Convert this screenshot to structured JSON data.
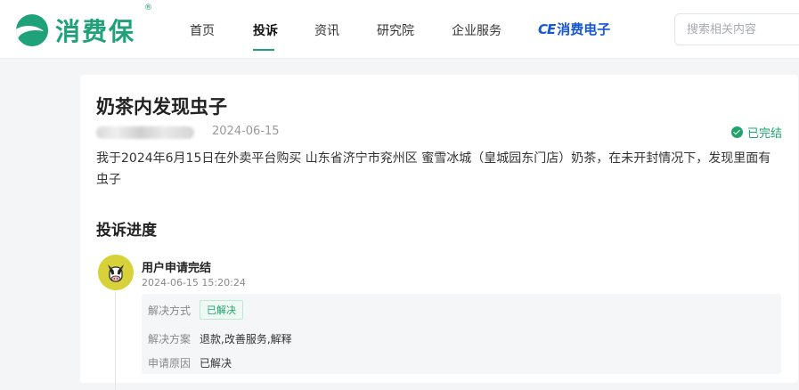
{
  "brand": {
    "name": "消费保",
    "registered": "®",
    "color": "#1fa17a"
  },
  "nav": {
    "items": [
      "首页",
      "投诉",
      "资讯",
      "研究院",
      "企业服务"
    ],
    "active": "投诉",
    "partner": {
      "ce": "CE",
      "label": "消费电子"
    }
  },
  "search": {
    "placeholder": "搜索相关内容"
  },
  "complaint": {
    "title": "奶茶内发现虫子",
    "date": "2024-06-15",
    "status": "已完结",
    "description": "我于2024年6月15日在外卖平台购买 山东省济宁市兖州区 蜜雪冰城（皇城园东门店）奶茶，在未开封情况下，发现里面有虫子"
  },
  "progress": {
    "section_title": "投诉进度",
    "step": {
      "title": "用户申请完结",
      "time": "2024-06-15 15:20:24",
      "method_label": "解决方式",
      "method_value": "已解决",
      "plan_label": "解决方案",
      "plan_value": "退款,改善服务,解释",
      "reason_label": "申请原因",
      "reason_value": "已解决"
    }
  }
}
